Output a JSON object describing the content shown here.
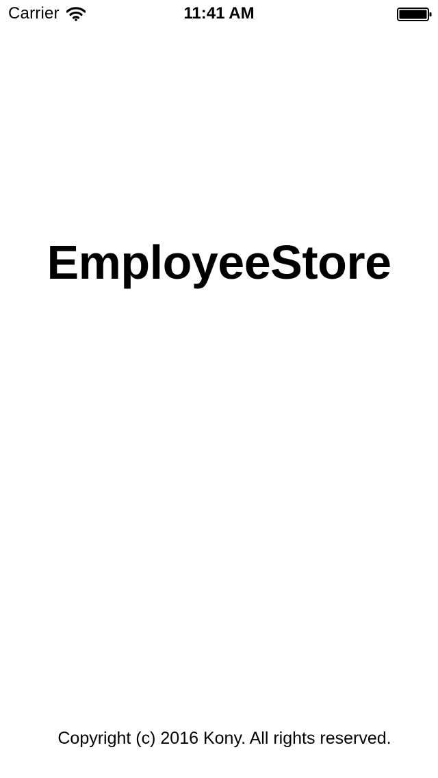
{
  "status_bar": {
    "carrier": "Carrier",
    "time": "11:41 AM",
    "wifi_icon": "wifi-icon",
    "battery_icon": "battery-full-icon",
    "battery_level": 1.0
  },
  "main": {
    "title": "EmployeeStore"
  },
  "footer": {
    "copyright": "Copyright (c) 2016 Kony. All rights reserved."
  },
  "colors": {
    "background": "#ffffff",
    "text": "#000000"
  }
}
